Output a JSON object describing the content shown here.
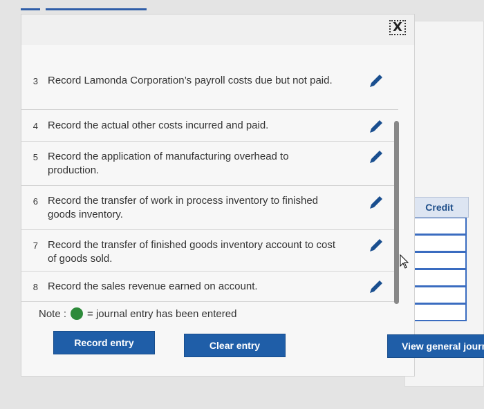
{
  "dialog": {
    "close_label": "X",
    "tasks": [
      {
        "num": "3",
        "text": "Record Lamonda Corporation’s payroll costs due but not paid."
      },
      {
        "num": "4",
        "text": "Record the actual other costs incurred and paid."
      },
      {
        "num": "5",
        "text": "Record the application of manufacturing overhead to production."
      },
      {
        "num": "6",
        "text": "Record the transfer of work in process inventory to finished goods inventory."
      },
      {
        "num": "7",
        "text": "Record the transfer of finished goods inventory account to cost of goods sold."
      },
      {
        "num": "8",
        "text": "Record the sales revenue earned on account."
      }
    ],
    "note": {
      "prefix": "Note :",
      "suffix": "= journal entry has been entered"
    },
    "buttons": {
      "record": "Record entry",
      "clear": "Clear entry"
    }
  },
  "side": {
    "credit_header": "Credit",
    "view_button": "View general journa"
  },
  "colors": {
    "accent": "#1f5ea8",
    "pencil": "#1a4f8f",
    "complete_dot": "#2d8a3a"
  },
  "icons": {
    "edit": "pencil-icon",
    "close": "close-icon",
    "note_dot": "green-dot-icon"
  }
}
